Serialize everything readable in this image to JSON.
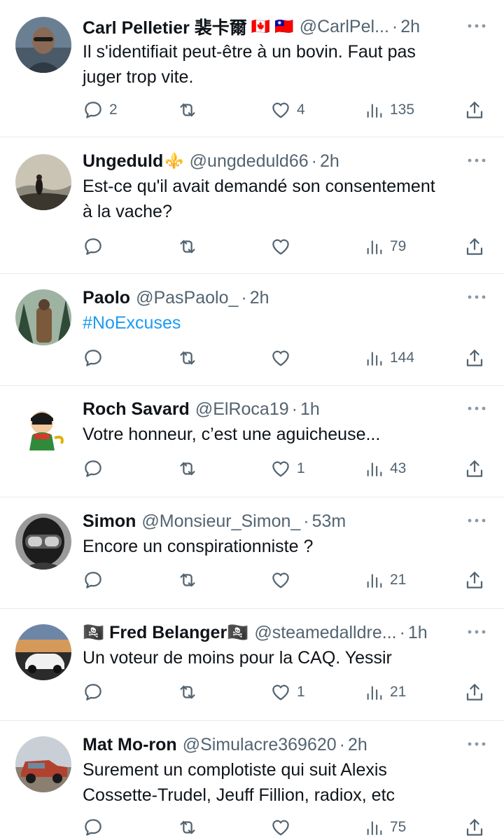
{
  "tweets": [
    {
      "name": "Carl Pelletier 裴卡爾",
      "badge": "🇨🇦 🇹🇼",
      "handle": "@CarlPel...",
      "time": "2h",
      "lines": [
        "Il s'identifiait peut-être à un bovin. Faut pas",
        "juger trop vite."
      ],
      "replies": "2",
      "retweets": "",
      "likes": "4",
      "views": "135"
    },
    {
      "name": "Ungeduld",
      "badge": "⚜️",
      "handle": "@ungdeduld66",
      "time": "2h",
      "lines": [
        "Est-ce qu'il avait demandé son consentement",
        "à la vache?"
      ],
      "replies": "",
      "retweets": "",
      "likes": "",
      "views": "79"
    },
    {
      "name": "Paolo",
      "badge": "",
      "handle": "@PasPaolo_",
      "time": "2h",
      "lines": [
        "#NoExcuses"
      ],
      "replies": "",
      "retweets": "",
      "likes": "",
      "views": "144"
    },
    {
      "name": "Roch Savard",
      "badge": "",
      "handle": "@ElRoca19",
      "time": "1h",
      "lines": [
        "Votre honneur, c’est une aguicheuse..."
      ],
      "replies": "",
      "retweets": "",
      "likes": "1",
      "views": "43"
    },
    {
      "name": "Simon",
      "badge": "",
      "handle": "@Monsieur_Simon_",
      "time": "53m",
      "lines": [
        "Encore un conspirationniste ?"
      ],
      "replies": "",
      "retweets": "",
      "likes": "",
      "views": "21"
    },
    {
      "name": "🏴‍☠️ Fred Belanger🏴‍☠️",
      "badge": "",
      "handle": "@steamedalldre...",
      "time": "1h",
      "lines": [
        "Un voteur de moins pour la CAQ. Yessir"
      ],
      "replies": "",
      "retweets": "",
      "likes": "1",
      "views": "21"
    },
    {
      "name": "Mat Mo-ron",
      "badge": "",
      "handle": "@Simulacre369620",
      "time": "2h",
      "lines": [
        "Surement un complotiste qui suit Alexis",
        "Cossette-Trudel, Jeuff Fillion, radiox, etc"
      ],
      "replies": "",
      "retweets": "",
      "likes": "",
      "views": "75"
    }
  ],
  "separator": "·",
  "colors": {
    "text": "#0f1419",
    "secondary": "#536471",
    "link": "#1d9bf0",
    "divider": "#e6e9ec"
  },
  "icons": {
    "reply": "speech-bubble-icon",
    "retweet": "retweet-arrows-icon",
    "like": "heart-icon",
    "views": "bar-chart-icon",
    "share": "share-upload-icon",
    "more": "more-dots-icon"
  }
}
